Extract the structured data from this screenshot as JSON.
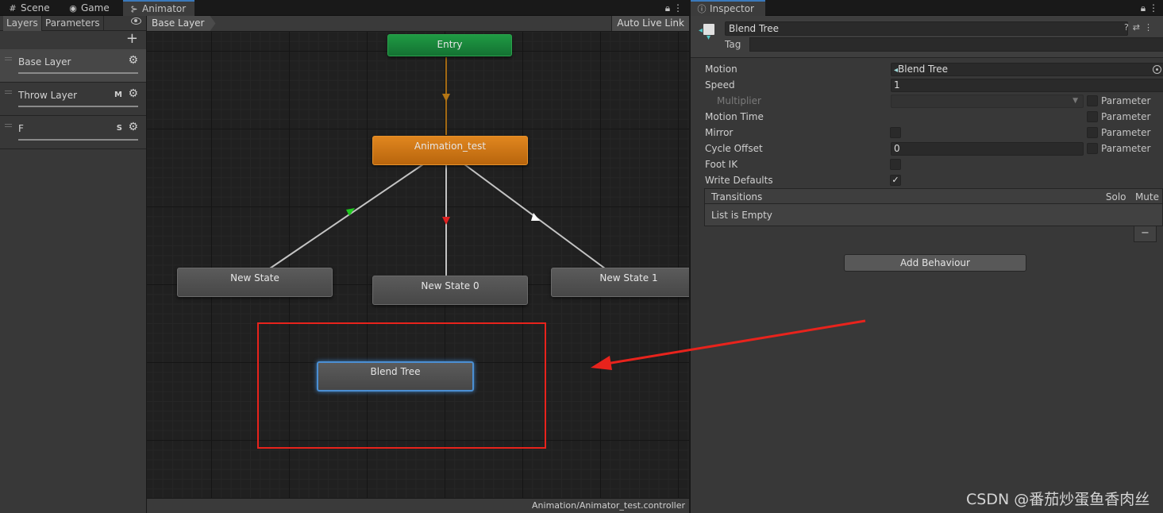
{
  "animator_tabs": [
    {
      "label": "Scene",
      "icon": "grid-icon"
    },
    {
      "label": "Game",
      "icon": "gamepad-icon"
    },
    {
      "label": "Animator",
      "icon": "animator-icon"
    }
  ],
  "sidebar": {
    "tabs": [
      "Layers",
      "Parameters"
    ],
    "layers": [
      {
        "name": "Base Layer",
        "flag": ""
      },
      {
        "name": "Throw Layer",
        "flag": "M"
      },
      {
        "name": "F",
        "flag": "S"
      }
    ]
  },
  "graph": {
    "breadcrumb": "Base Layer",
    "live_link": "Auto Live Link",
    "nodes": {
      "entry": "Entry",
      "default": "Animation_test",
      "s0": "New State",
      "s1": "New State 0",
      "s2": "New State 1",
      "blend": "Blend Tree"
    },
    "status_path": "Animation/Animator_test.controller"
  },
  "inspector": {
    "tab_label": "Inspector",
    "object_name": "Blend Tree",
    "tag_label": "Tag",
    "properties": {
      "motion_label": "Motion",
      "motion_value": "Blend Tree",
      "speed_label": "Speed",
      "speed_value": "1",
      "multiplier_label": "Multiplier",
      "motion_time_label": "Motion Time",
      "mirror_label": "Mirror",
      "cycle_offset_label": "Cycle Offset",
      "cycle_offset_value": "0",
      "foot_ik_label": "Foot IK",
      "write_defaults_label": "Write Defaults",
      "parameter_label": "Parameter"
    },
    "transitions": {
      "header": "Transitions",
      "solo": "Solo",
      "mute": "Mute",
      "empty": "List is Empty",
      "remove": "−"
    },
    "add_behaviour": "Add Behaviour"
  },
  "watermark": "CSDN @番茄炒蛋鱼香肉丝",
  "colors": {
    "entry": "#1f9a43",
    "default_state": "#e0861f",
    "selection": "#4b8fd3",
    "annotation": "#e8231c"
  }
}
